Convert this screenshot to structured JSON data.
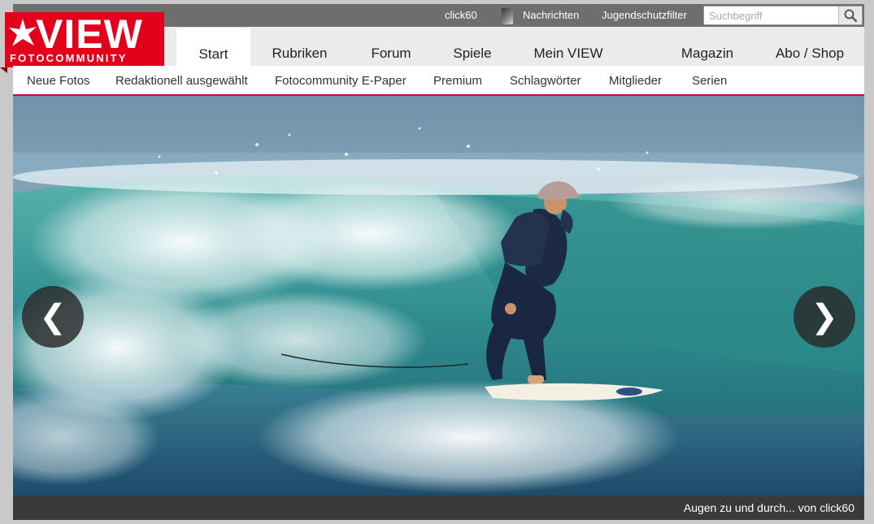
{
  "topbar": {
    "username": "click60",
    "links": [
      "Nachrichten",
      "Jugendschutzfilter"
    ],
    "search_placeholder": "Suchbegriff"
  },
  "logo": {
    "wordmark": "VIEW",
    "subtitle": "FOTOCOMMUNITY"
  },
  "nav": {
    "tabs": [
      "Start",
      "Rubriken",
      "Forum",
      "Spiele",
      "Mein VIEW",
      "Magazin",
      "Abo / Shop"
    ],
    "active": "Start"
  },
  "subnav": {
    "items": [
      "Neue Fotos",
      "Redaktionell ausgewählt",
      "Fotocommunity E-Paper",
      "Premium",
      "Schlagwörter",
      "Mitglieder",
      "Serien"
    ]
  },
  "slideshow": {
    "caption": "Augen zu und durch... von click60",
    "prev_glyph": "❮",
    "next_glyph": "❯"
  },
  "colors": {
    "brand_red": "#e3001b",
    "topbar_gray": "#6e6e6e",
    "nav_gray": "#ebebeb"
  }
}
